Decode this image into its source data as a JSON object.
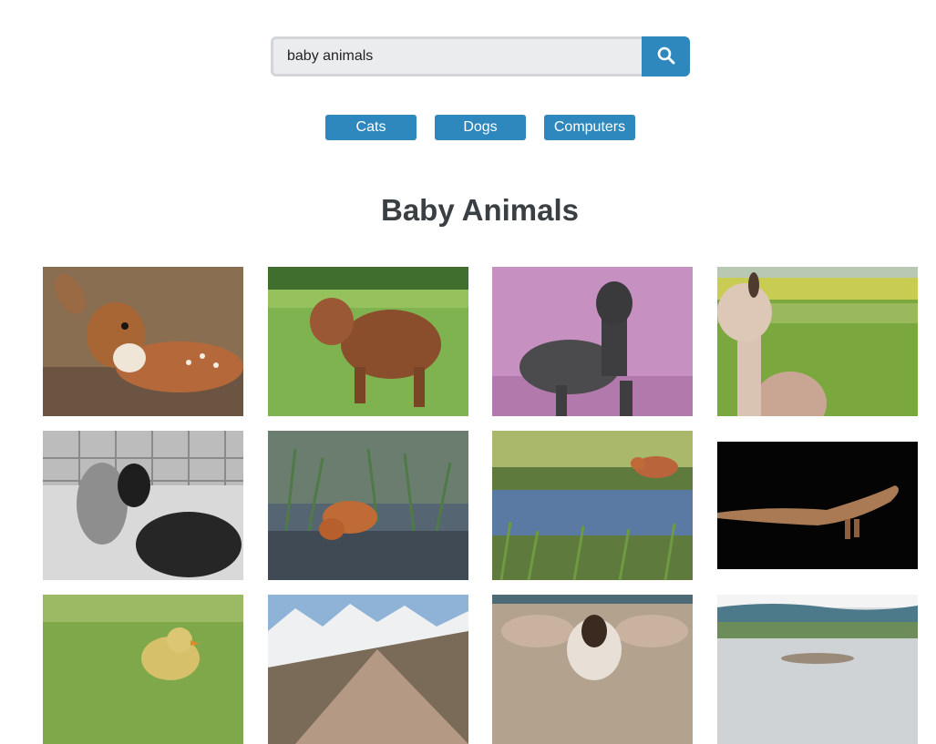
{
  "search": {
    "value": "baby animals",
    "button_icon": "search-icon"
  },
  "categories": [
    {
      "label": "Cats"
    },
    {
      "label": "Dogs"
    },
    {
      "label": "Computers"
    }
  ],
  "heading": "Baby Animals",
  "images": [
    {
      "subject": "fawn"
    },
    {
      "subject": "highland calf"
    },
    {
      "subject": "black alpaca"
    },
    {
      "subject": "alpaca"
    },
    {
      "subject": "alpacas"
    },
    {
      "subject": "fox kit"
    },
    {
      "subject": "fox kit"
    },
    {
      "subject": "lizard"
    },
    {
      "subject": "gosling"
    },
    {
      "subject": "mountains"
    },
    {
      "subject": "goat kid"
    },
    {
      "subject": "lake"
    }
  ],
  "colors": {
    "accent": "#2e88bd",
    "heading": "#3a3f44"
  }
}
